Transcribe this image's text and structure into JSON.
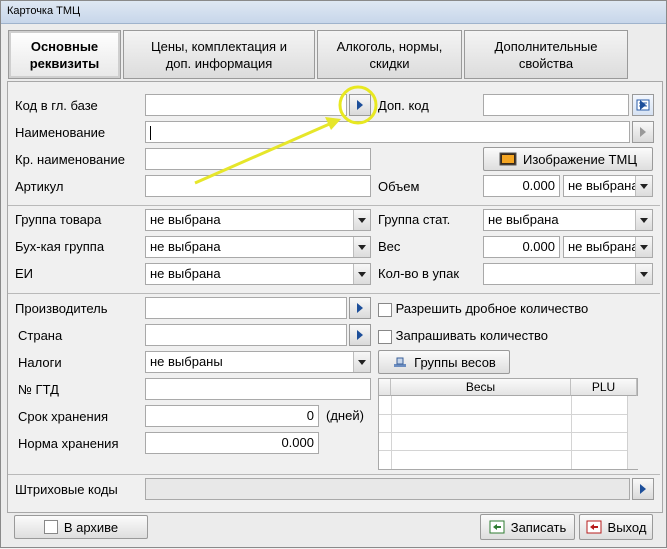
{
  "window": {
    "title": "Карточка ТМЦ"
  },
  "tabs": [
    {
      "line1": "Основные",
      "line2": "реквизиты"
    },
    {
      "line1": "Цены, комплектация и",
      "line2": "доп.  информация"
    },
    {
      "line1": "Алкоголь, нормы,",
      "line2": "скидки"
    },
    {
      "line1": "Дополнительные",
      "line2": "свойства"
    }
  ],
  "fields": {
    "code_label": "Код в гл. базе",
    "dop_code_label": "Доп. код",
    "name_label": "Наименование",
    "short_name_label": "Кр. наименование",
    "article_label": "Артикул",
    "volume_label": "Объем",
    "volume_value": "0.000",
    "volume_unit": "не выбрана",
    "image_button": "Изображение ТМЦ",
    "group_label": "Группа товара",
    "group_value": "не выбрана",
    "stat_group_label": "Группа стат.",
    "stat_group_value": "не выбрана",
    "buh_group_label": "Бух-кая группа",
    "buh_group_value": "не выбрана",
    "weight_label": "Вес",
    "weight_value": "0.000",
    "weight_unit": "не выбрана",
    "ei_label": "ЕИ",
    "ei_value": "не выбрана",
    "pack_qty_label": "Кол-во в упак",
    "producer_label": "Производитель",
    "country_label": "Страна",
    "taxes_label": "Налоги",
    "taxes_value": "не выбраны",
    "gtd_label": "№ ГТД",
    "shelf_life_label": "Срок хранения",
    "shelf_life_value": "0",
    "shelf_life_unit": "(дней)",
    "storage_norm_label": "Норма хранения",
    "storage_norm_value": "0.000",
    "allow_fraction_label": "Разрешить дробное количество",
    "ask_qty_label": "Запрашивать количество",
    "weight_groups_button": "Группы весов",
    "scales_col": "Весы",
    "plu_col": "PLU",
    "barcodes_label": "Штриховые коды"
  },
  "footer": {
    "archive_label": "В архиве",
    "save_button": "Записать",
    "exit_button": "Выход"
  },
  "colors": {
    "highlight": "#e8e820",
    "arrow": "#e6e62a",
    "accent": "#1d4f9a"
  }
}
